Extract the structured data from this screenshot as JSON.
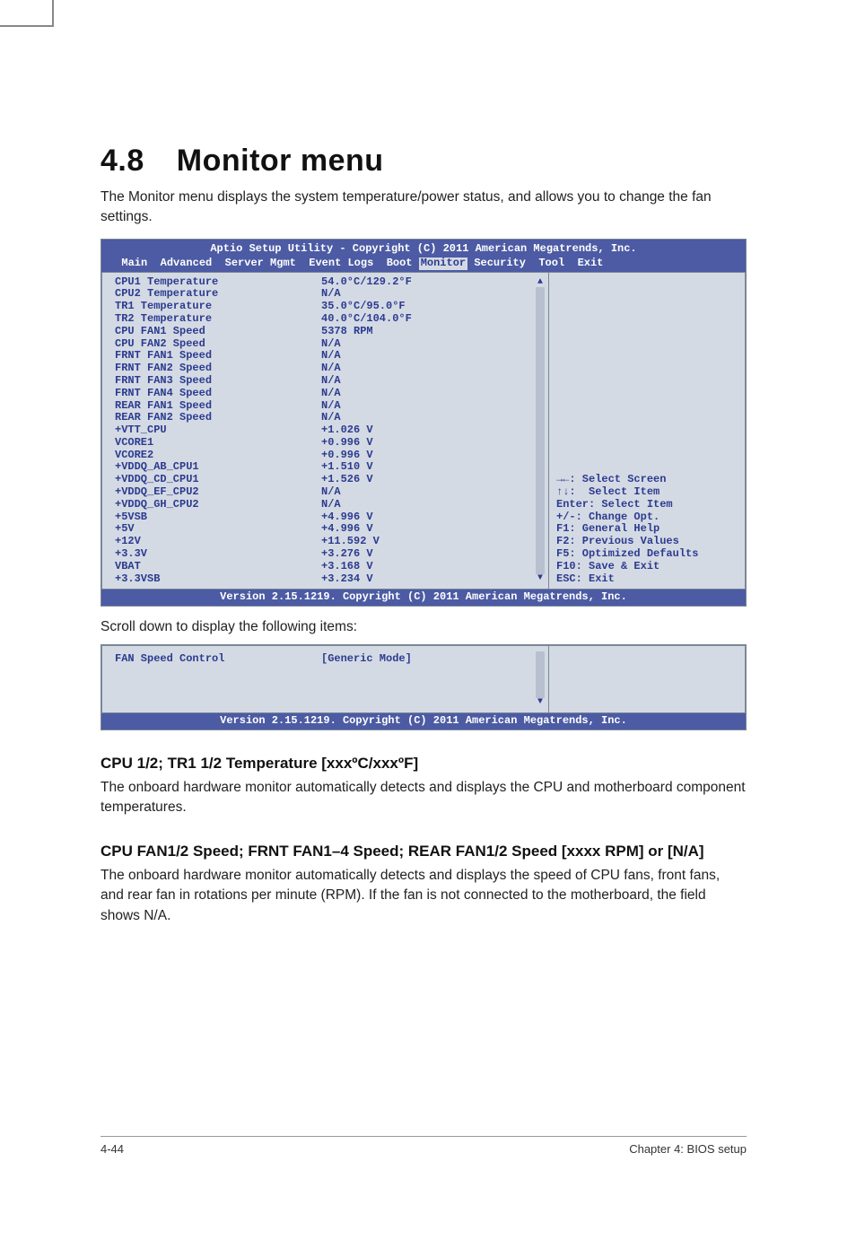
{
  "section": {
    "number": "4.8",
    "title": "Monitor menu"
  },
  "intro": "The Monitor menu displays the system temperature/power status, and allows you to change the fan settings.",
  "bios": {
    "title": "Aptio Setup Utility - Copyright (C) 2011 American Megatrends, Inc.",
    "menubar": [
      "Main",
      "Advanced",
      "Server Mgmt",
      "Event Logs",
      "Boot",
      "Monitor",
      "Security",
      "Tool",
      "Exit"
    ],
    "selected_tab": "Monitor",
    "rows": [
      {
        "label": "CPU1 Temperature",
        "value": "54.0°C/129.2°F"
      },
      {
        "label": "CPU2 Temperature",
        "value": "N/A"
      },
      {
        "label": "TR1 Temperature",
        "value": "35.0°C/95.0°F"
      },
      {
        "label": "TR2 Temperature",
        "value": "40.0°C/104.0°F"
      },
      {
        "label": "CPU FAN1 Speed",
        "value": "5378 RPM"
      },
      {
        "label": "CPU FAN2 Speed",
        "value": "N/A"
      },
      {
        "label": "FRNT FAN1 Speed",
        "value": "N/A"
      },
      {
        "label": "FRNT FAN2 Speed",
        "value": "N/A"
      },
      {
        "label": "FRNT FAN3 Speed",
        "value": "N/A"
      },
      {
        "label": "FRNT FAN4 Speed",
        "value": "N/A"
      },
      {
        "label": "REAR FAN1 Speed",
        "value": "N/A"
      },
      {
        "label": "REAR FAN2 Speed",
        "value": "N/A"
      },
      {
        "label": "+VTT_CPU",
        "value": "+1.026 V"
      },
      {
        "label": "VCORE1",
        "value": "+0.996 V"
      },
      {
        "label": "VCORE2",
        "value": "+0.996 V"
      },
      {
        "label": "+VDDQ_AB_CPU1",
        "value": "+1.510 V"
      },
      {
        "label": "+VDDQ_CD_CPU1",
        "value": "+1.526 V"
      },
      {
        "label": "+VDDQ_EF_CPU2",
        "value": "N/A"
      },
      {
        "label": "+VDDQ_GH_CPU2",
        "value": "N/A"
      },
      {
        "label": "+5VSB",
        "value": "+4.996 V"
      },
      {
        "label": "+5V",
        "value": "+4.996 V"
      },
      {
        "label": "+12V",
        "value": "+11.592 V"
      },
      {
        "label": "+3.3V",
        "value": "+3.276 V"
      },
      {
        "label": "VBAT",
        "value": "+3.168 V"
      },
      {
        "label": "+3.3VSB",
        "value": "+3.234 V"
      }
    ],
    "help": [
      "→←: Select Screen",
      "↑↓:  Select Item",
      "Enter: Select Item",
      "+/-: Change Opt.",
      "F1: General Help",
      "F2: Previous Values",
      "F5: Optimized Defaults",
      "F10: Save & Exit",
      "ESC: Exit"
    ],
    "footer": "Version 2.15.1219. Copyright (C) 2011 American Megatrends, Inc."
  },
  "scroll_caption": "Scroll down to display the following items:",
  "bios_small": {
    "row": {
      "label": "FAN Speed Control",
      "value": "[Generic Mode]"
    },
    "footer": "Version 2.15.1219. Copyright (C) 2011 American Megatrends, Inc."
  },
  "sub1": {
    "heading": "CPU 1/2; TR1 1/2 Temperature [xxxºC/xxxºF]",
    "body": "The onboard hardware monitor automatically detects and displays the CPU and motherboard component temperatures."
  },
  "sub2": {
    "heading": "CPU FAN1/2 Speed; FRNT FAN1–4 Speed; REAR FAN1/2 Speed [xxxx RPM] or [N/A]",
    "body": "The onboard hardware monitor automatically detects and displays the speed of CPU fans, front fans, and rear fan in rotations per minute (RPM). If the fan is not connected to the motherboard, the field shows N/A."
  },
  "footer": {
    "left": "4-44",
    "right": "Chapter 4: BIOS setup"
  }
}
